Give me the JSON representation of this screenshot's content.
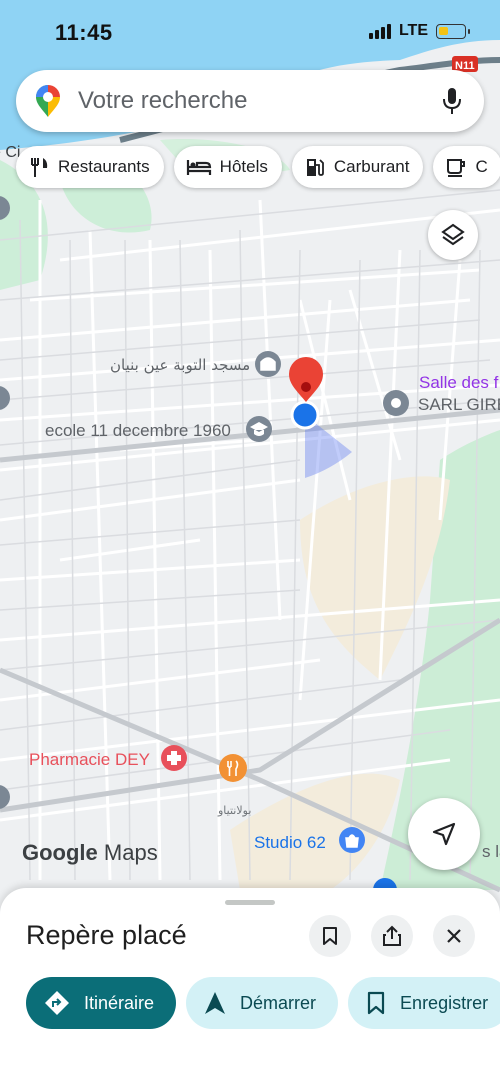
{
  "status_bar": {
    "time": "11:45",
    "network": "LTE"
  },
  "search": {
    "placeholder": "Votre recherche"
  },
  "chips": [
    {
      "label": "Restaurants",
      "icon": "fork-knife-icon"
    },
    {
      "label": "Hôtels",
      "icon": "bed-icon"
    },
    {
      "label": "Carburant",
      "icon": "fuel-pump-icon"
    },
    {
      "label": "C",
      "icon": "cafe-cup-icon"
    }
  ],
  "map": {
    "shield_label": "N11",
    "top_left_label": "e Ci",
    "places": {
      "mosque": "مسجد التوبة عين بنيان",
      "school": "ecole 11 decembre 1960",
      "salle": "Salle des f",
      "sarl": "SARL GIRE",
      "pharmacy": "Pharmacie DEY",
      "district": "بولانتياو",
      "studio": "Studio 62",
      "edge": "s la"
    },
    "attribution": {
      "brand": "Google",
      "product": "Maps"
    }
  },
  "colors": {
    "water": "#8fd3f4",
    "park": "#c8ecd3",
    "sand": "#f3ecdc",
    "road": "#ffffff",
    "accent": "#0b6e78",
    "pin": "#ea4335",
    "location": "#1a73e8"
  },
  "bottom_sheet": {
    "title": "Repère placé",
    "actions": [
      {
        "label": "Itinéraire",
        "icon": "directions-icon"
      },
      {
        "label": "Démarrer",
        "icon": "navigation-arrow-icon"
      },
      {
        "label": "Enregistrer",
        "icon": "bookmark-icon"
      }
    ]
  }
}
